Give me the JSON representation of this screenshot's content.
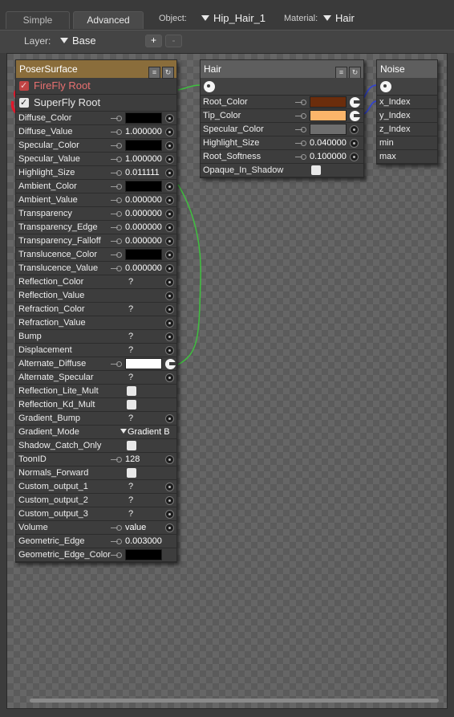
{
  "tabs": {
    "simple": "Simple",
    "advanced": "Advanced"
  },
  "header": {
    "object_label": "Object:",
    "object_value": "Hip_Hair_1",
    "material_label": "Material:",
    "material_value": "Hair"
  },
  "layer": {
    "label": "Layer:",
    "value": "Base",
    "add": "+",
    "remove": "-"
  },
  "poser_surface": {
    "title": "PoserSurface",
    "firefly_root": "FireFly Root",
    "superfly_root": "SuperFly Root",
    "rows": [
      {
        "label": "Diffuse_Color",
        "kind": "color",
        "color": "#000000",
        "key": true,
        "dot": true
      },
      {
        "label": "Diffuse_Value",
        "kind": "value",
        "value": "1.000000",
        "key": true,
        "dot": true
      },
      {
        "label": "Specular_Color",
        "kind": "color",
        "color": "#000000",
        "key": true,
        "dot": true
      },
      {
        "label": "Specular_Value",
        "kind": "value",
        "value": "1.000000",
        "key": true,
        "dot": true
      },
      {
        "label": "Highlight_Size",
        "kind": "value",
        "value": "0.011111",
        "key": true,
        "dot": true
      },
      {
        "label": "Ambient_Color",
        "kind": "color",
        "color": "#000000",
        "key": true,
        "dot": true
      },
      {
        "label": "Ambient_Value",
        "kind": "value",
        "value": "0.000000",
        "key": true,
        "dot": true
      },
      {
        "label": "Transparency",
        "kind": "value",
        "value": "0.000000",
        "key": true,
        "dot": true
      },
      {
        "label": "Transparency_Edge",
        "kind": "value",
        "value": "0.000000",
        "key": true,
        "dot": true
      },
      {
        "label": "Transparency_Falloff",
        "kind": "value",
        "value": "0.000000",
        "key": true,
        "dot": true
      },
      {
        "label": "Translucence_Color",
        "kind": "color",
        "color": "#000000",
        "key": true,
        "dot": true
      },
      {
        "label": "Translucence_Value",
        "kind": "value",
        "value": "0.000000",
        "key": true,
        "dot": true
      },
      {
        "label": "Reflection_Color",
        "kind": "q",
        "value": "?",
        "dot": true
      },
      {
        "label": "Reflection_Value",
        "kind": "none",
        "dot": true
      },
      {
        "label": "Refraction_Color",
        "kind": "q",
        "value": "?",
        "dot": true
      },
      {
        "label": "Refraction_Value",
        "kind": "none",
        "dot": true
      },
      {
        "label": "Bump",
        "kind": "q",
        "value": "?",
        "dot": true
      },
      {
        "label": "Displacement",
        "kind": "q",
        "value": "?",
        "dot": true
      },
      {
        "label": "Alternate_Diffuse",
        "kind": "color",
        "color": "#ffffff",
        "key": true,
        "plug": true
      },
      {
        "label": "Alternate_Specular",
        "kind": "q",
        "value": "?",
        "dot": true
      },
      {
        "label": "Reflection_Lite_Mult",
        "kind": "check"
      },
      {
        "label": "Reflection_Kd_Mult",
        "kind": "check"
      },
      {
        "label": "Gradient_Bump",
        "kind": "q",
        "value": "?",
        "dot": true
      },
      {
        "label": "Gradient_Mode",
        "kind": "menu",
        "value": "Gradient B"
      },
      {
        "label": "Shadow_Catch_Only",
        "kind": "check"
      },
      {
        "label": "ToonID",
        "kind": "value",
        "value": "128",
        "key": true,
        "dot": true
      },
      {
        "label": "Normals_Forward",
        "kind": "check"
      },
      {
        "label": "Custom_output_1",
        "kind": "q",
        "value": "?",
        "dot": true
      },
      {
        "label": "Custom_output_2",
        "kind": "q",
        "value": "?",
        "dot": true
      },
      {
        "label": "Custom_output_3",
        "kind": "q",
        "value": "?",
        "dot": true
      },
      {
        "label": "Volume",
        "kind": "value",
        "value": "value",
        "key": true,
        "dot": true
      },
      {
        "label": "Geometric_Edge",
        "kind": "value",
        "value": "0.003000",
        "key": true
      },
      {
        "label": "Geometric_Edge_Color",
        "kind": "color",
        "color": "#000000",
        "key": true
      }
    ]
  },
  "hair": {
    "title": "Hair",
    "rows": [
      {
        "label": "Root_Color",
        "kind": "color",
        "color": "#6b2d0c",
        "key": true,
        "plug": true
      },
      {
        "label": "Tip_Color",
        "kind": "color",
        "color": "#fbb56a",
        "key": true,
        "plug": true
      },
      {
        "label": "Specular_Color",
        "kind": "color",
        "color": "#6e6e6e",
        "key": true,
        "dot": true
      },
      {
        "label": "Highlight_Size",
        "kind": "value",
        "value": "0.040000",
        "key": true,
        "dot": true
      },
      {
        "label": "Root_Softness",
        "kind": "value",
        "value": "0.100000",
        "key": true,
        "dot": true
      },
      {
        "label": "Opaque_In_Shadow",
        "kind": "check"
      }
    ]
  },
  "noise": {
    "title": "Noise",
    "rows": [
      {
        "label": "x_Index",
        "kind": "none"
      },
      {
        "label": "y_Index",
        "kind": "none"
      },
      {
        "label": "z_Index",
        "kind": "none"
      },
      {
        "label": "min",
        "kind": "none"
      },
      {
        "label": "max",
        "kind": "none"
      }
    ]
  },
  "colors": {
    "poser_header": "#8a6d3b",
    "hair_header": "#5e5e5e",
    "noise_header": "#5e5e5e",
    "root_disabled_text": "#e87070",
    "root_checkbox_red": "#c04444",
    "wire_green": "#3fbf3f",
    "wire_blue": "#3344cc",
    "annotation_circle": "#e0182c"
  }
}
